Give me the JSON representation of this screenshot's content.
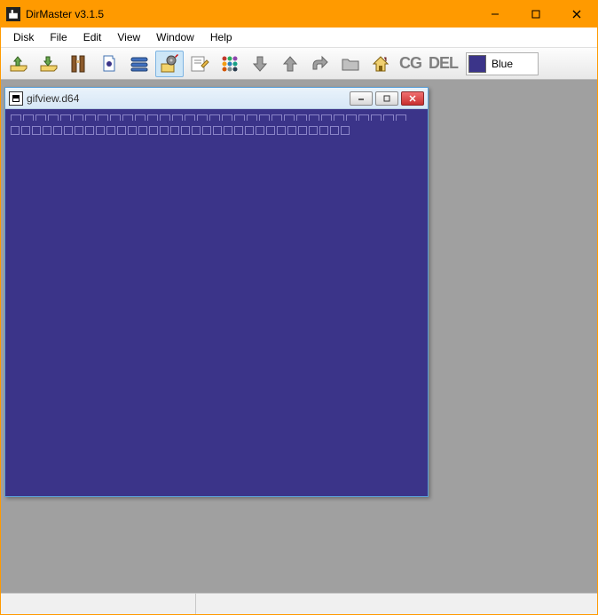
{
  "app": {
    "title": "DirMaster v3.1.5"
  },
  "menu": {
    "items": [
      "Disk",
      "File",
      "Edit",
      "View",
      "Window",
      "Help"
    ]
  },
  "toolbar": {
    "buttons": [
      {
        "name": "open-arrow-up-icon"
      },
      {
        "name": "open-arrow-down-icon"
      },
      {
        "name": "import-icon"
      },
      {
        "name": "copy-file-icon"
      },
      {
        "name": "bam-icon"
      },
      {
        "name": "disk-operation-icon",
        "active": true
      },
      {
        "name": "edit-icon"
      },
      {
        "name": "colors-grid-icon"
      },
      {
        "name": "arrow-down-icon"
      },
      {
        "name": "arrow-up-icon"
      },
      {
        "name": "arrow-forward-icon"
      },
      {
        "name": "folder-icon"
      },
      {
        "name": "house-icon"
      }
    ],
    "cg_label": "CG",
    "del_label": "DEL",
    "color": {
      "swatch": "#3b3489",
      "label": "Blue"
    }
  },
  "child": {
    "title": "gifview.d64"
  },
  "dir": {
    "cols_row1": 32,
    "cols_row2": 32
  }
}
